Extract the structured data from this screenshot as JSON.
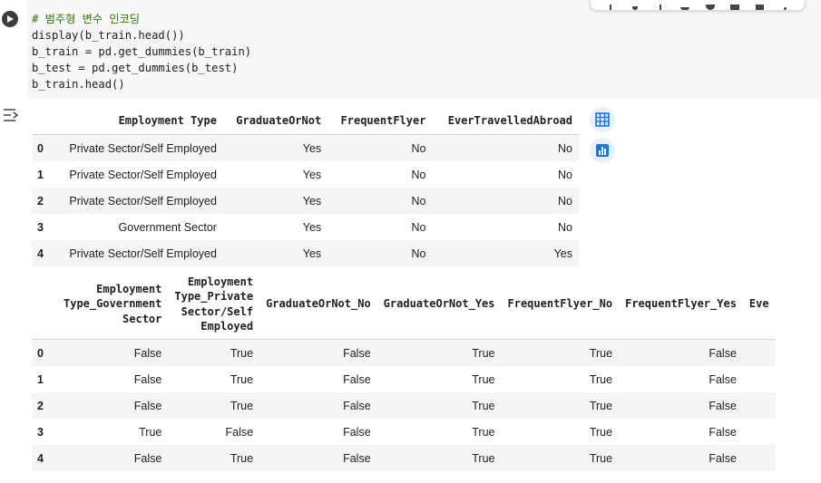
{
  "code_cell": {
    "lines": [
      "# 범주형 변수 인코딩",
      "display(b_train.head())",
      "b_train = pd.get_dummies(b_train)",
      "b_test = pd.get_dummies(b_test)",
      "b_train.head()"
    ]
  },
  "toolbar": {
    "icons": [
      "arrow-up-icon",
      "arrow-down-icon",
      "link-icon",
      "comment-icon",
      "gear-icon",
      "mirror-icon",
      "delete-icon",
      "more-icon"
    ]
  },
  "output_1": {
    "columns": [
      "",
      "Employment Type",
      "GraduateOrNot",
      "FrequentFlyer",
      "EverTravelledAbroad"
    ],
    "rows": [
      [
        "0",
        "Private Sector/Self Employed",
        "Yes",
        "No",
        "No"
      ],
      [
        "1",
        "Private Sector/Self Employed",
        "Yes",
        "No",
        "No"
      ],
      [
        "2",
        "Private Sector/Self Employed",
        "Yes",
        "No",
        "No"
      ],
      [
        "3",
        "Government Sector",
        "Yes",
        "No",
        "No"
      ],
      [
        "4",
        "Private Sector/Self Employed",
        "Yes",
        "No",
        "Yes"
      ]
    ]
  },
  "output_2": {
    "columns": [
      "",
      [
        "Employment",
        "Type_Government",
        "Sector"
      ],
      [
        "Employment",
        "Type_Private",
        "Sector/Self",
        "Employed"
      ],
      "GraduateOrNot_No",
      "GraduateOrNot_Yes",
      "FrequentFlyer_No",
      "FrequentFlyer_Yes",
      "Eve"
    ],
    "rows": [
      [
        "0",
        "False",
        "True",
        "False",
        "True",
        "True",
        "False"
      ],
      [
        "1",
        "False",
        "True",
        "False",
        "True",
        "True",
        "False"
      ],
      [
        "2",
        "False",
        "True",
        "False",
        "True",
        "True",
        "False"
      ],
      [
        "3",
        "True",
        "False",
        "False",
        "True",
        "True",
        "False"
      ],
      [
        "4",
        "False",
        "True",
        "False",
        "True",
        "True",
        "False"
      ]
    ]
  },
  "colors": {
    "code_bg": "#f7f7f7",
    "comment": "#2b7a0b",
    "accent": "#1a73e8",
    "stripe": "#f5f5f5"
  }
}
